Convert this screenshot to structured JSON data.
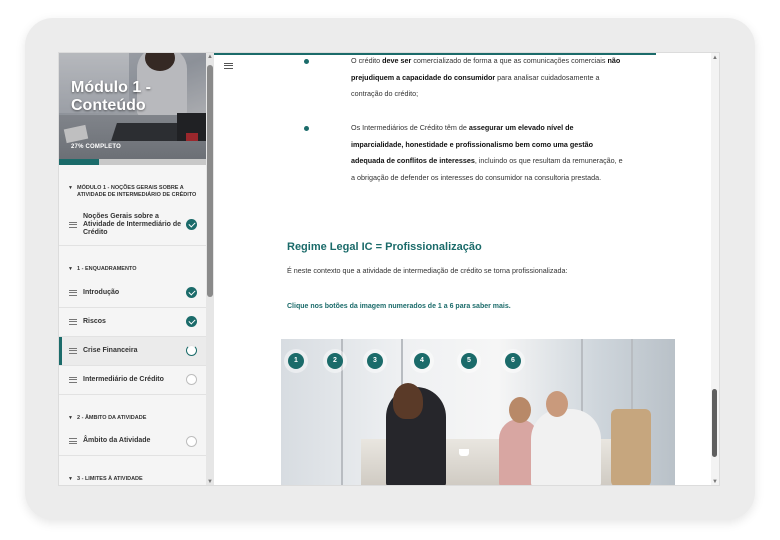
{
  "sidebar": {
    "module_title": "Módulo 1 - Conteúdo",
    "progress_label": "27% COMPLETO",
    "progress_value": 0.27,
    "items": [
      {
        "type": "section",
        "label": "MÓDULO 1 - NOÇÕES GERAIS SOBRE A ATIVIDADE DE INTERMEDIÁRIO DE CRÉDITO"
      },
      {
        "type": "lesson",
        "label": "Noções Gerais sobre a Atividade de Intermediário de Crédito",
        "status": "done"
      },
      {
        "type": "section",
        "label": "1 - ENQUADRAMENTO"
      },
      {
        "type": "lesson",
        "label": "Introdução",
        "status": "done"
      },
      {
        "type": "lesson",
        "label": "Riscos",
        "status": "done"
      },
      {
        "type": "lesson",
        "label": "Crise Financeira",
        "status": "partial"
      },
      {
        "type": "lesson",
        "label": "Intermediário de Crédito",
        "status": "pending"
      },
      {
        "type": "section",
        "label": "2 - ÂMBITO DA ATIVIDADE"
      },
      {
        "type": "lesson",
        "label": "Âmbito da Atividade",
        "status": "pending"
      },
      {
        "type": "section",
        "label": "3 - LIMITES À ATIVIDADE"
      }
    ]
  },
  "main": {
    "bullets": [
      {
        "segments": [
          {
            "text": "O crédito ",
            "bold": false
          },
          {
            "text": "deve ser",
            "bold": true
          },
          {
            "text": " comercializado de forma a que as comunicações comerciais ",
            "bold": false
          },
          {
            "text": "não prejudiquem a capacidade do consumidor",
            "bold": true
          },
          {
            "text": " para analisar cuidadosamente a contração do crédito;",
            "bold": false
          }
        ]
      },
      {
        "segments": [
          {
            "text": "Os Intermediários de Crédito têm de ",
            "bold": false
          },
          {
            "text": "assegurar um elevado nível de imparcialidade, honestidade e profissionalismo bem como uma gestão adequada de conflitos de interesses",
            "bold": true
          },
          {
            "text": ", incluindo os que resultam da remuneração, e a obrigação de defender os interesses do consumidor na consultoria prestada.",
            "bold": false
          }
        ]
      }
    ],
    "heading": "Regime Legal IC = Profissionalização",
    "intro": "É neste contexto que a atividade de intermediação de crédito se torna profissionalizada:",
    "cta": "Clique nos botões da imagem numerados de 1 a 6 para saber mais.",
    "hotspots": [
      "1",
      "2",
      "3",
      "4",
      "5",
      "6"
    ]
  },
  "colors": {
    "accent": "#1b6b6a",
    "sidebar_bg": "#f5f5f5"
  }
}
